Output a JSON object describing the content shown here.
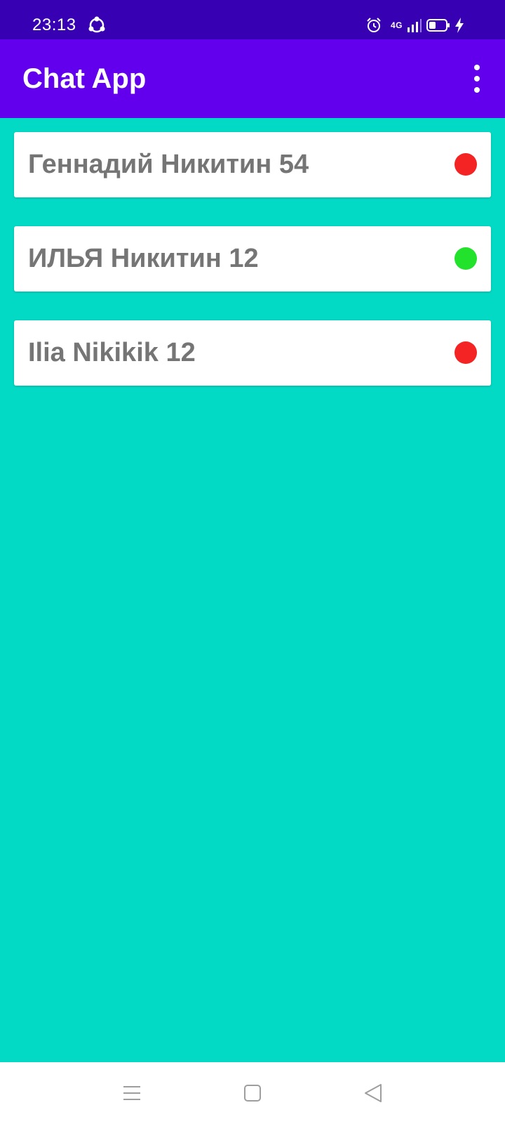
{
  "status_bar": {
    "time": "23:13",
    "network": "4G",
    "icons": [
      "sync-icon",
      "alarm-icon",
      "signal-icon",
      "battery-icon",
      "charging-icon"
    ]
  },
  "app_bar": {
    "title": "Chat App",
    "menu_icon": "more-vert-icon"
  },
  "users": [
    {
      "name": "Геннадий Никитин 54",
      "online": false,
      "status_color": "#F42424"
    },
    {
      "name": "ИЛЬЯ Никитин 12",
      "online": true,
      "status_color": "#23E22B"
    },
    {
      "name": "Ilia Nikikik 12",
      "online": false,
      "status_color": "#F42424"
    }
  ],
  "nav_bar": {
    "buttons": [
      "recents-icon",
      "home-icon",
      "back-icon"
    ]
  },
  "colors": {
    "status_bar": "#3700B3",
    "app_bar": "#6200EE",
    "background": "#03DAC5",
    "card": "#FFFFFF",
    "name_text": "#757575",
    "online": "#23E22B",
    "offline": "#F42424"
  }
}
